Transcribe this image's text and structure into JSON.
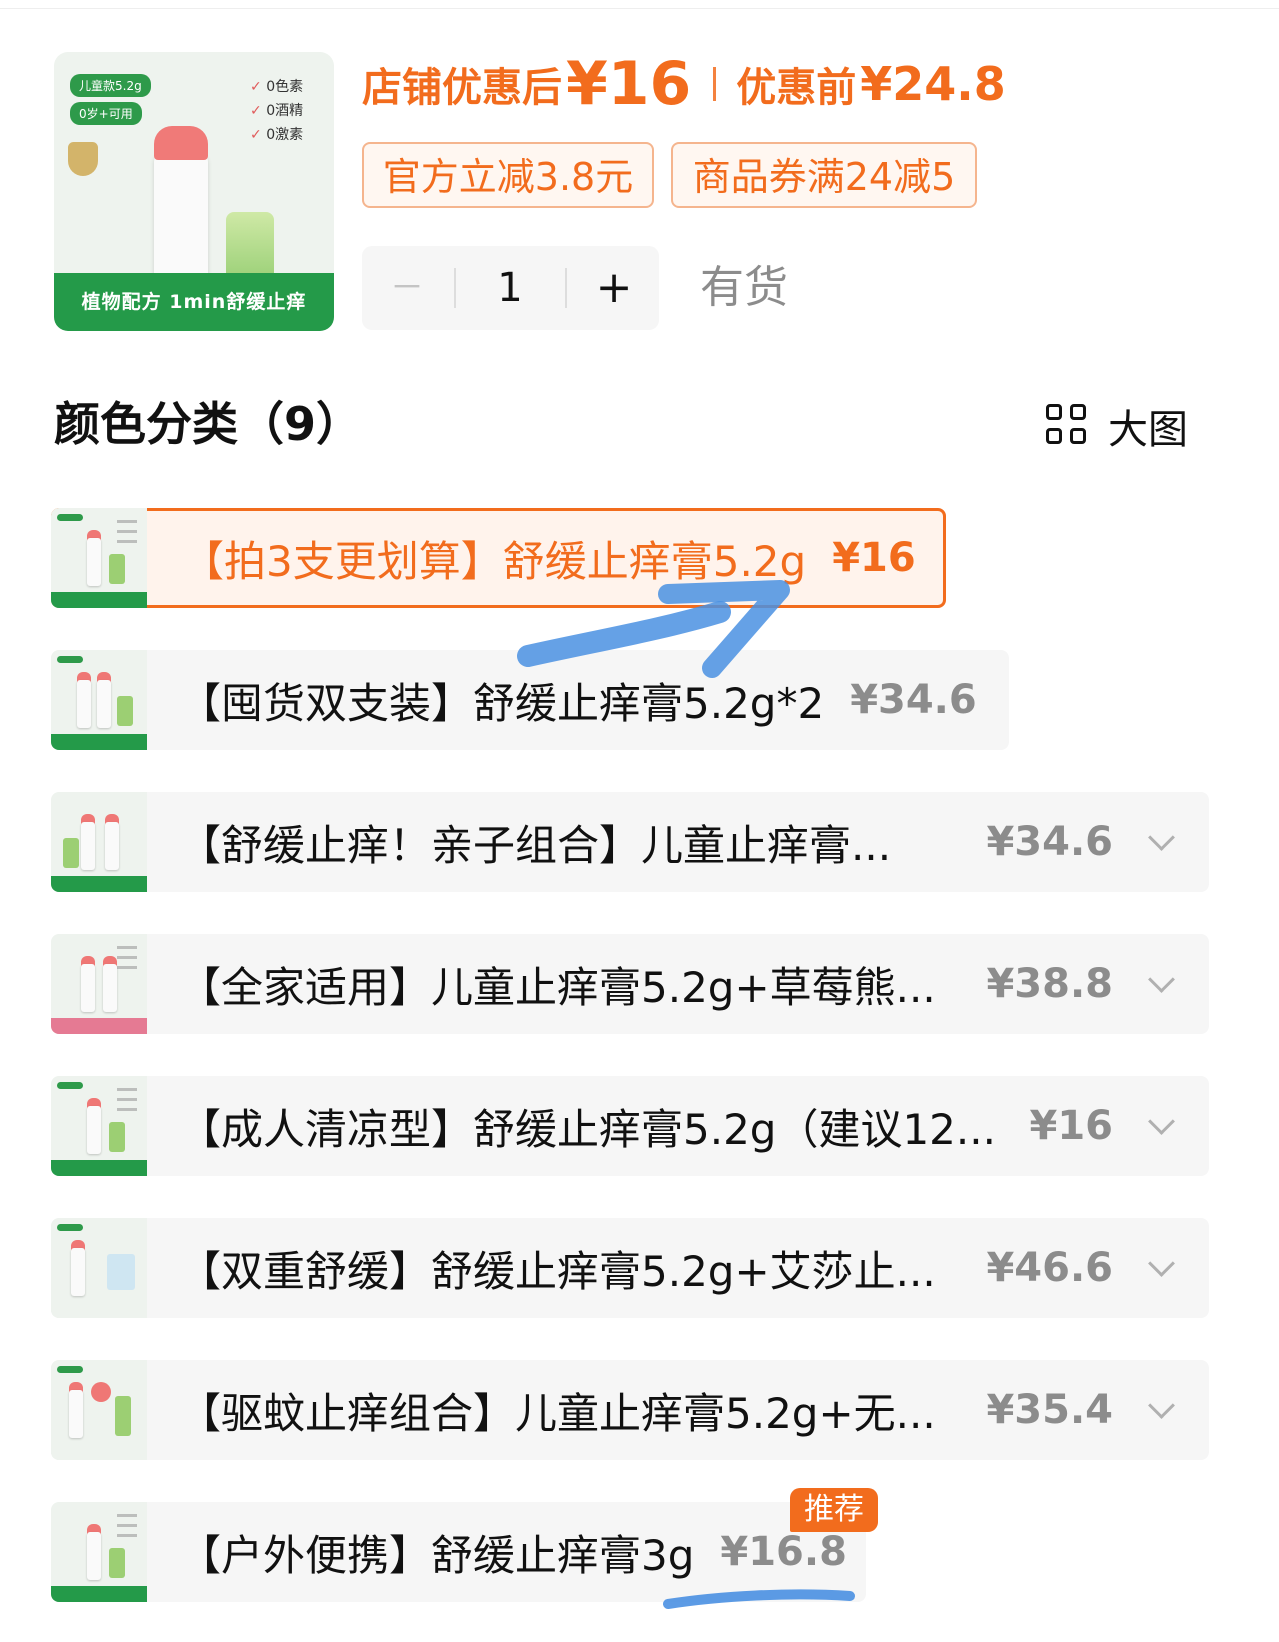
{
  "product": {
    "thumb_badges": [
      "儿童款5.2g",
      "0岁+可用"
    ],
    "thumb_claims": [
      "0色素",
      "0酒精",
      "0激素"
    ],
    "thumb_banner": "植物配方 1min舒缓止痒",
    "price_after_label": "店铺优惠后",
    "price_after": "¥16",
    "price_before_label": "优惠前",
    "price_before": "¥24.8",
    "coupons": [
      "官方立减3.8元",
      "商品券满24减5"
    ],
    "quantity": "1",
    "minus_label": "－",
    "plus_label": "+",
    "stock_status": "有货"
  },
  "variants": {
    "title": "颜色分类（9）",
    "view_toggle_label": "大图",
    "items": [
      {
        "label": "【拍3支更划算】舒缓止痒膏5.2g",
        "price": "¥16",
        "selected": true
      },
      {
        "label": "【囤货双支装】舒缓止痒膏5.2g*2",
        "price": "¥34.6",
        "selected": false
      },
      {
        "label": "【舒缓止痒！亲子组合】儿童止痒膏...",
        "price": "¥34.6",
        "selected": false
      },
      {
        "label": "【全家适用】儿童止痒膏5.2g+草莓熊...",
        "price": "¥38.8",
        "selected": false
      },
      {
        "label": "【成人清凉型】舒缓止痒膏5.2g（建议12...",
        "price": "¥16",
        "selected": false
      },
      {
        "label": "【双重舒缓】舒缓止痒膏5.2g+艾莎止...",
        "price": "¥46.6",
        "selected": false
      },
      {
        "label": "【驱蚊止痒组合】儿童止痒膏5.2g+无...",
        "price": "¥35.4",
        "selected": false
      },
      {
        "label": "【户外便携】舒缓止痒膏3g",
        "price": "¥16.8",
        "selected": false,
        "badge": "推荐"
      }
    ]
  },
  "colors": {
    "accent": "#f26c1d",
    "annotation": "#4a90e2",
    "brand_green": "#249a49"
  }
}
